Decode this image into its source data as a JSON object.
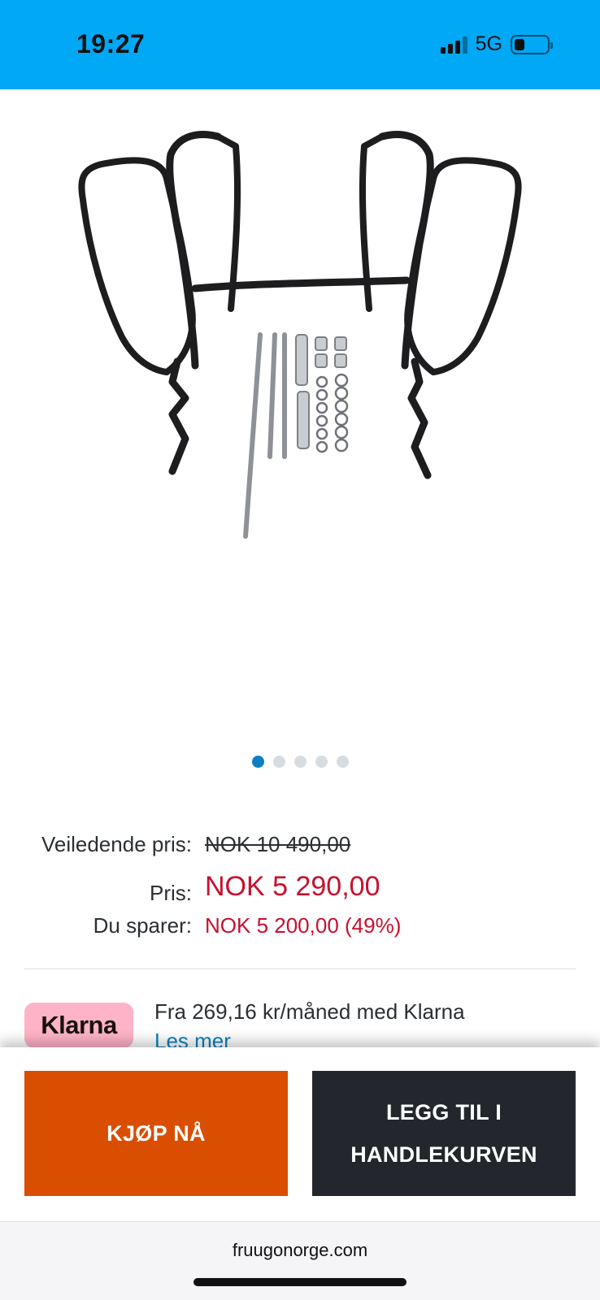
{
  "status_bar": {
    "time": "19:27",
    "network": "5G",
    "signal_bars_active": 3,
    "signal_bars_total": 4,
    "battery_level": 0.3,
    "background_color": "#00a8f5"
  },
  "product_image": {
    "icon": "motorcycle-crash-bar-kit-image",
    "carousel_count": 5,
    "carousel_active_index": 0
  },
  "pricing": {
    "guide_label": "Veiledende pris:",
    "guide_value": "NOK 10 490,00",
    "price_label": "Pris:",
    "price_value": "NOK 5 290,00",
    "savings_label": "Du sparer:",
    "savings_value": "NOK 5 200,00 (49%)",
    "accent_color": "#c8102e"
  },
  "klarna": {
    "logo_text": "Klarna",
    "installment_text": "Fra 269,16 kr/måned med Klarna",
    "link_text": "Les mer",
    "badge_color": "#ffb3c7"
  },
  "actions": {
    "buy_now_label": "KJØP NÅ",
    "add_to_cart_label": "LEGG TIL I HANDLEKURVEN",
    "buy_color": "#d94e00",
    "cart_color": "#23272d"
  },
  "browser": {
    "domain": "fruugonorge.com"
  }
}
